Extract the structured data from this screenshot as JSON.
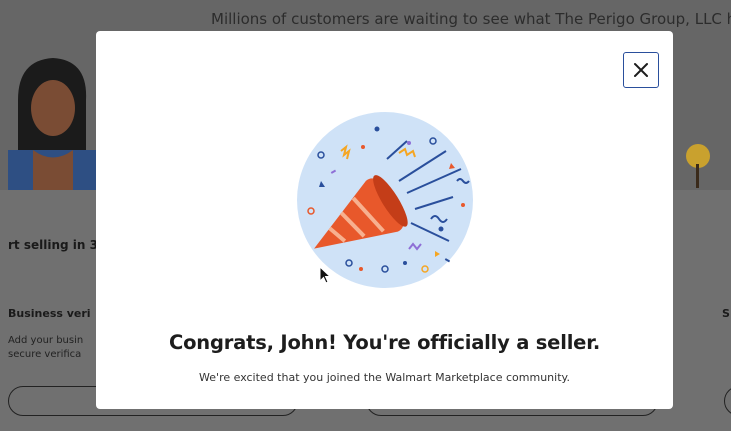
{
  "background": {
    "tagline": "Millions of customers are waiting to see what The Perigo Group, LLC h",
    "heading": "rt selling in 3",
    "step_title": "Business veri",
    "step_desc_line1": "Add your busin",
    "step_desc_line2": "secure verifica",
    "right_letter": "S"
  },
  "modal": {
    "title": "Congrats, John! You're officially a seller.",
    "subtitle": "We're excited that you joined the Walmart Marketplace community.",
    "close_icon": "close-icon",
    "illustration_icon": "party-popper-icon"
  },
  "colors": {
    "accent": "#2a4f9c",
    "illustration_bg": "#cfe2f7",
    "popper": "#e8582b"
  }
}
